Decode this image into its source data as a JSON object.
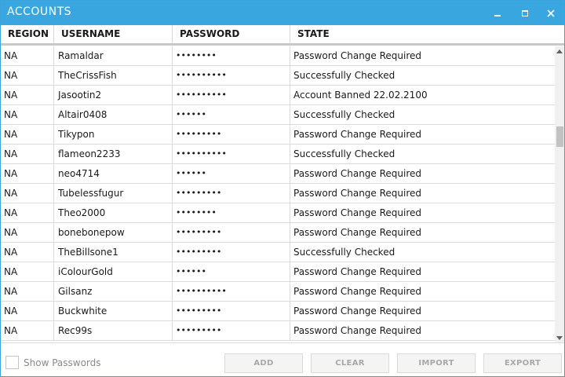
{
  "window": {
    "title": "ACCOUNTS",
    "accent_color": "#3aa6e0"
  },
  "columns": [
    "REGION",
    "USERNAME",
    "PASSWORD",
    "STATE"
  ],
  "rows": [
    {
      "region": "NA",
      "username": "Ramaldar",
      "password": "••••••••",
      "state": "Password Change Required"
    },
    {
      "region": "NA",
      "username": "TheCrissFish",
      "password": "••••••••••",
      "state": "Successfully Checked"
    },
    {
      "region": "NA",
      "username": "Jasootin2",
      "password": "••••••••••",
      "state": "Account Banned 22.02.2100"
    },
    {
      "region": "NA",
      "username": "Altair0408",
      "password": "••••••",
      "state": "Successfully Checked"
    },
    {
      "region": "NA",
      "username": "Tikypon",
      "password": "•••••••••",
      "state": "Password Change Required"
    },
    {
      "region": "NA",
      "username": "flameon2233",
      "password": "••••••••••",
      "state": "Successfully Checked"
    },
    {
      "region": "NA",
      "username": "neo4714",
      "password": "••••••",
      "state": "Password Change Required"
    },
    {
      "region": "NA",
      "username": "Tubelessfugur",
      "password": "•••••••••",
      "state": "Password Change Required"
    },
    {
      "region": "NA",
      "username": "Theo2000",
      "password": "••••••••",
      "state": "Password Change Required"
    },
    {
      "region": "NA",
      "username": "bonebonepow",
      "password": "•••••••••",
      "state": "Password Change Required"
    },
    {
      "region": "NA",
      "username": "TheBillsone1",
      "password": "•••••••••",
      "state": "Successfully Checked"
    },
    {
      "region": "NA",
      "username": "iColourGold",
      "password": "••••••",
      "state": "Password Change Required"
    },
    {
      "region": "NA",
      "username": "Gilsanz",
      "password": "••••••••••",
      "state": "Password Change Required"
    },
    {
      "region": "NA",
      "username": "Buckwhite",
      "password": "•••••••••",
      "state": "Password Change Required"
    },
    {
      "region": "NA",
      "username": "Rec99s",
      "password": "•••••••••",
      "state": "Password Change Required"
    }
  ],
  "footer": {
    "show_passwords_label": "Show Passwords",
    "show_passwords_checked": false,
    "buttons": {
      "add": "ADD",
      "clear": "CLEAR",
      "import": "IMPORT",
      "export": "EXPORT"
    }
  }
}
